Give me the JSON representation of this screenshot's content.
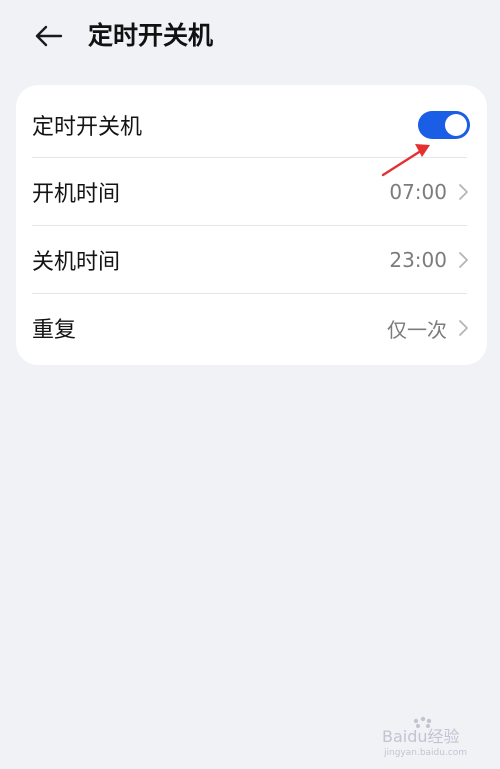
{
  "header": {
    "title": "定时开关机",
    "back_icon": "arrow-left-icon"
  },
  "settings": {
    "timer_switch": {
      "label": "定时开关机",
      "enabled": true,
      "toggle_color": "#1a5ee6"
    },
    "power_on_time": {
      "label": "开机时间",
      "value": "07:00"
    },
    "power_off_time": {
      "label": "关机时间",
      "value": "23:00"
    },
    "repeat": {
      "label": "重复",
      "value": "仅一次"
    }
  },
  "annotation": {
    "arrow_color": "#e53030"
  },
  "watermark": {
    "text": "Baidu经验",
    "subtext": "jingyan.baidu.com"
  },
  "colors": {
    "background": "#f1f2f6",
    "card": "#ffffff",
    "accent": "#1a5ee6",
    "secondary_text": "#7c7c7c"
  }
}
